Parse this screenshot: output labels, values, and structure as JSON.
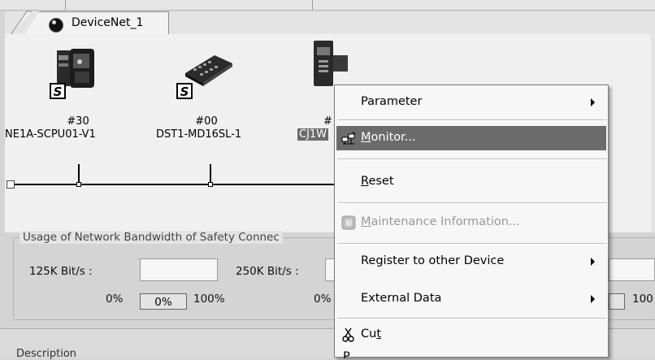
{
  "tab": {
    "label": "DeviceNet_1",
    "icon": "network-globe-icon"
  },
  "devices": [
    {
      "number": "#30",
      "name": "NE1A-SCPU01-V1",
      "badge": "S",
      "icon": "safety-controller-icon"
    },
    {
      "number": "#00",
      "name": "DST1-MD16SL-1",
      "badge": "S",
      "icon": "safety-io-terminal-icon"
    },
    {
      "number": "#",
      "name": "CJ1W",
      "icon": "cj1w-unit-icon"
    }
  ],
  "usage": {
    "title": "Usage of Network Bandwidth of Safety Connec",
    "f125": {
      "label": "125K Bit/s :",
      "min": "0%",
      "value": "0%",
      "max": "100%"
    },
    "f250": {
      "label": "250K Bit/s :",
      "min": "0%"
    },
    "f500": {
      "max": "100"
    }
  },
  "bottom": {
    "label": "Description"
  },
  "menu": {
    "parameter": "Parameter",
    "monitor_prefix": "M",
    "monitor_rest": "onitor...",
    "reset_prefix": "R",
    "reset_rest": "eset",
    "maint_prefix": "M",
    "maint_rest": "aintenance Information...",
    "register": "Register to other Device",
    "external": "External Data",
    "cut_a": "Cu",
    "cut_u": "t",
    "copy_glyph": "P"
  }
}
